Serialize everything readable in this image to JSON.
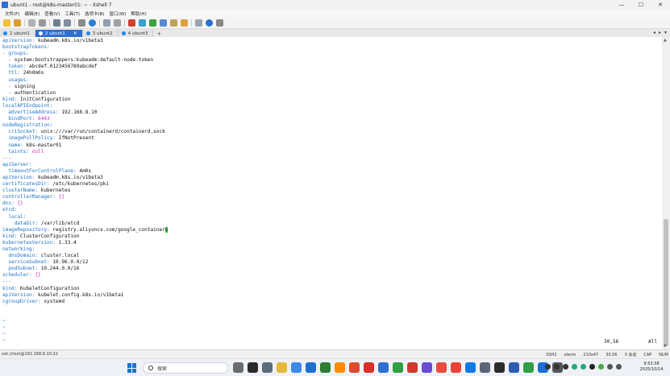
{
  "window": {
    "title": "ubunt1 - root@k8s-master01: ~ - Xshell 7",
    "controls": [
      "—",
      "☐",
      "✕"
    ]
  },
  "menu": [
    "文件(F)",
    "编辑(E)",
    "查看(V)",
    "工具(T)",
    "选项卡(B)",
    "窗口(W)",
    "帮助(H)"
  ],
  "tabs": [
    {
      "label": "1 ubunt1",
      "active": false
    },
    {
      "label": "2 ubunt1",
      "active": true,
      "close": "✕"
    },
    {
      "label": "3 ubunt2",
      "active": false
    },
    {
      "label": "4 ubunt3",
      "active": false
    }
  ],
  "tab_add": "+",
  "terminal": {
    "lines": [
      [
        [
          "k",
          "apiVersion: "
        ],
        [
          "v",
          "kubeadm.k8s.io/v1beta3"
        ]
      ],
      [
        [
          "k",
          "bootstrapTokens:"
        ]
      ],
      [
        [
          "r",
          "- "
        ],
        [
          "k",
          "groups:"
        ]
      ],
      [
        [
          "t",
          "  "
        ],
        [
          "r",
          "- "
        ],
        [
          "v",
          "system:bootstrappers:kubeadm:default-node-token"
        ]
      ],
      [
        [
          "t",
          "  "
        ],
        [
          "k",
          "token: "
        ],
        [
          "v",
          "abcdef.0123456789abcdef"
        ]
      ],
      [
        [
          "t",
          "  "
        ],
        [
          "k",
          "ttl: "
        ],
        [
          "v",
          "24h0m0s"
        ]
      ],
      [
        [
          "t",
          "  "
        ],
        [
          "k",
          "usages:"
        ]
      ],
      [
        [
          "t",
          "  "
        ],
        [
          "r",
          "- "
        ],
        [
          "v",
          "signing"
        ]
      ],
      [
        [
          "t",
          "  "
        ],
        [
          "r",
          "- "
        ],
        [
          "v",
          "authentication"
        ]
      ],
      [
        [
          "k",
          "kind: "
        ],
        [
          "v",
          "InitConfiguration"
        ]
      ],
      [
        [
          "k",
          "localAPIEndpoint:"
        ]
      ],
      [
        [
          "t",
          "  "
        ],
        [
          "k",
          "advertiseAddress: "
        ],
        [
          "v",
          "192.168.8.10"
        ]
      ],
      [
        [
          "t",
          "  "
        ],
        [
          "k",
          "bindPort: "
        ],
        [
          "p",
          "6443"
        ]
      ],
      [
        [
          "k",
          "nodeRegistration:"
        ]
      ],
      [
        [
          "t",
          "  "
        ],
        [
          "k",
          "criSocket: "
        ],
        [
          "v",
          "unix:///var/run/containerd/containerd.sock"
        ]
      ],
      [
        [
          "t",
          "  "
        ],
        [
          "k",
          "imagePullPolicy: "
        ],
        [
          "v",
          "IfNotPresent"
        ]
      ],
      [
        [
          "t",
          "  "
        ],
        [
          "k",
          "name: "
        ],
        [
          "v",
          "k8s-master01"
        ]
      ],
      [
        [
          "t",
          "  "
        ],
        [
          "k",
          "taints: "
        ],
        [
          "p",
          "null"
        ]
      ],
      [
        [
          "d",
          "---"
        ]
      ],
      [
        [
          "k",
          "apiServer:"
        ]
      ],
      [
        [
          "t",
          "  "
        ],
        [
          "k",
          "timeoutForControlPlane: "
        ],
        [
          "v",
          "4m0s"
        ]
      ],
      [
        [
          "k",
          "apiVersion: "
        ],
        [
          "v",
          "kubeadm.k8s.io/v1beta3"
        ]
      ],
      [
        [
          "k",
          "certificatesDir: "
        ],
        [
          "v",
          "/etc/kubernetes/pki"
        ]
      ],
      [
        [
          "k",
          "clusterName: "
        ],
        [
          "v",
          "kubernetes"
        ]
      ],
      [
        [
          "k",
          "controllerManager: "
        ],
        [
          "p",
          "{}"
        ]
      ],
      [
        [
          "k",
          "dns: "
        ],
        [
          "p",
          "{}"
        ]
      ],
      [
        [
          "k",
          "etcd:"
        ]
      ],
      [
        [
          "t",
          "  "
        ],
        [
          "k",
          "local:"
        ]
      ],
      [
        [
          "t",
          "    "
        ],
        [
          "k",
          "dataDir: "
        ],
        [
          "v",
          "/var/lib/etcd"
        ]
      ],
      [
        [
          "k",
          "imageRepository: "
        ],
        [
          "v",
          "registry.aliyuncs.com/google_container"
        ],
        [
          "c",
          "s"
        ]
      ],
      [
        [
          "k",
          "kind: "
        ],
        [
          "v",
          "ClusterConfiguration"
        ]
      ],
      [
        [
          "k",
          "kubernetesVersion: "
        ],
        [
          "v",
          "1.33.4"
        ]
      ],
      [
        [
          "k",
          "networking:"
        ]
      ],
      [
        [
          "t",
          "  "
        ],
        [
          "k",
          "dnsDomain: "
        ],
        [
          "v",
          "cluster.local"
        ]
      ],
      [
        [
          "t",
          "  "
        ],
        [
          "k",
          "serviceSubnet: "
        ],
        [
          "v",
          "10.96.0.0/12"
        ]
      ],
      [
        [
          "t",
          "  "
        ],
        [
          "k",
          "podSubnet: "
        ],
        [
          "v",
          "10.244.0.0/16"
        ]
      ],
      [
        [
          "k",
          "scheduler: "
        ],
        [
          "p",
          "{}"
        ]
      ],
      [
        [
          "d",
          "---"
        ]
      ],
      [
        [
          "k",
          "kind: "
        ],
        [
          "v",
          "KubeletConfiguration"
        ]
      ],
      [
        [
          "k",
          "apiVersion: "
        ],
        [
          "v",
          "kubelet.config.k8s.io/v1beta1"
        ]
      ],
      [
        [
          "k",
          "cgroupDriver: "
        ],
        [
          "v",
          "systemd"
        ]
      ],
      [
        [
          "t",
          ""
        ]
      ],
      [
        [
          "t",
          ""
        ]
      ],
      [
        [
          "tl",
          "~"
        ]
      ],
      [
        [
          "tl",
          "~"
        ]
      ],
      [
        [
          "tl",
          "~"
        ]
      ],
      [
        [
          "tl",
          "~"
        ]
      ]
    ],
    "position": "30,56",
    "scroll": "All"
  },
  "statusbar": {
    "connection": "ssh://root@192.168.8.10:22",
    "right": [
      "SSH2",
      "xterm",
      "210x47",
      "30,56",
      "3 会话",
      "CAP",
      "NUM"
    ]
  },
  "taskbar": {
    "search_placeholder": "搜索",
    "time": "9:53:38",
    "date": "2025/10/14",
    "app_colors": [
      "#6b6b6b",
      "#2a2a2a",
      "#5a6b7a",
      "#e6b73a",
      "#3d89e6",
      "#1e6fd1",
      "#2e7d32",
      "#ff8a00",
      "#d94c2b",
      "#d9302a",
      "#2f6fcf",
      "#2ea043",
      "#cc3a2e",
      "#6a4bd1",
      "#e74c3c",
      "#ea4335",
      "#0f7ae5",
      "#5b6577",
      "#2b2b2b",
      "#2b5cb0",
      "#2f9e44",
      "#1d6fd6",
      "#555555"
    ],
    "tray_colors": [
      "#333",
      "#333",
      "#333",
      "#2a7",
      "#2a7",
      "#222",
      "#4a4",
      "#555",
      "#555"
    ]
  }
}
